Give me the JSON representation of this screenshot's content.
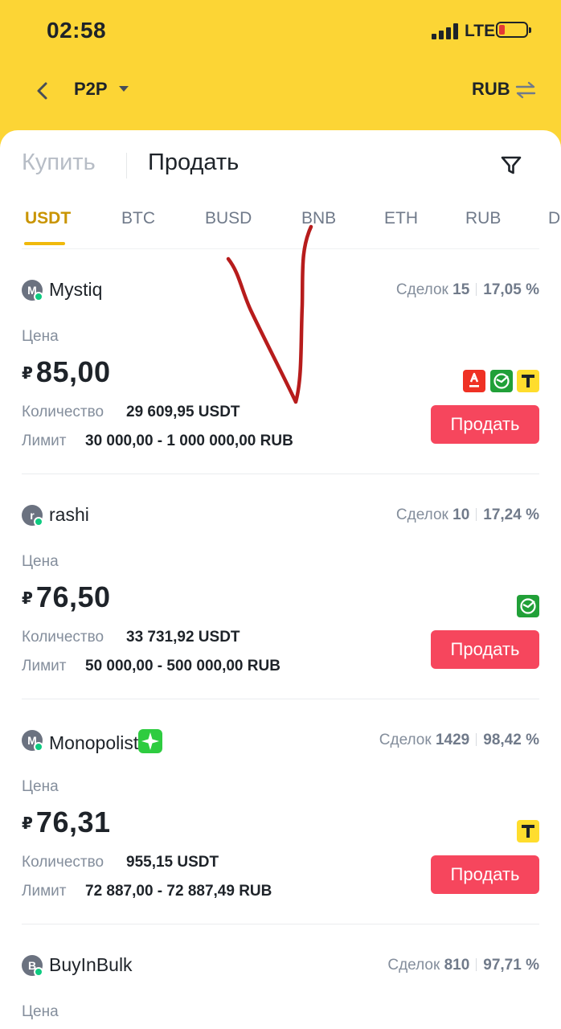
{
  "status_bar": {
    "time": "02:58",
    "network": "LTE",
    "battery_color": "#E53935"
  },
  "nav": {
    "title": "P2P",
    "currency": "RUB"
  },
  "trade_tabs": {
    "buy": "Купить",
    "sell": "Продать",
    "active": "sell"
  },
  "coins": [
    "USDT",
    "BTC",
    "BUSD",
    "BNB",
    "ETH",
    "RUB",
    "D"
  ],
  "active_coin": "USDT",
  "labels": {
    "deals": "Сделок",
    "price": "Цена",
    "quantity": "Количество",
    "limit": "Лимит",
    "sell_button": "Продать",
    "currency_symbol": "₽"
  },
  "offers": [
    {
      "avatar": "M",
      "name": "Mystiq",
      "deals": "15",
      "rate": "17,05 %",
      "price": "85,00",
      "quantity": "29 609,95  USDT",
      "limit": "30 000,00 - 1 000 000,00 RUB",
      "payments": [
        "alfa-bank",
        "sberbank",
        "tinkoff"
      ]
    },
    {
      "avatar": "r",
      "name": "rashi",
      "deals": "10",
      "rate": "17,24 %",
      "price": "76,50",
      "quantity": "33 731,92  USDT",
      "limit": "50 000,00 - 500 000,00 RUB",
      "payments": [
        "sberbank"
      ]
    },
    {
      "avatar": "M",
      "name": "Monopolist",
      "deals": "1429",
      "rate": "98,42 %",
      "price": "76,31",
      "quantity": "955,15  USDT",
      "limit": "72 887,00 - 72 887,49 RUB",
      "payments": [
        "tinkoff"
      ]
    },
    {
      "avatar": "B",
      "name": "BuyInBulk",
      "deals": "810",
      "rate": "97,71 %"
    }
  ],
  "colors": {
    "header_yellow": "#FCD535",
    "accent": "#F0B90B",
    "sell_red": "#F6465D",
    "annotation_red": "#B71C1C"
  }
}
